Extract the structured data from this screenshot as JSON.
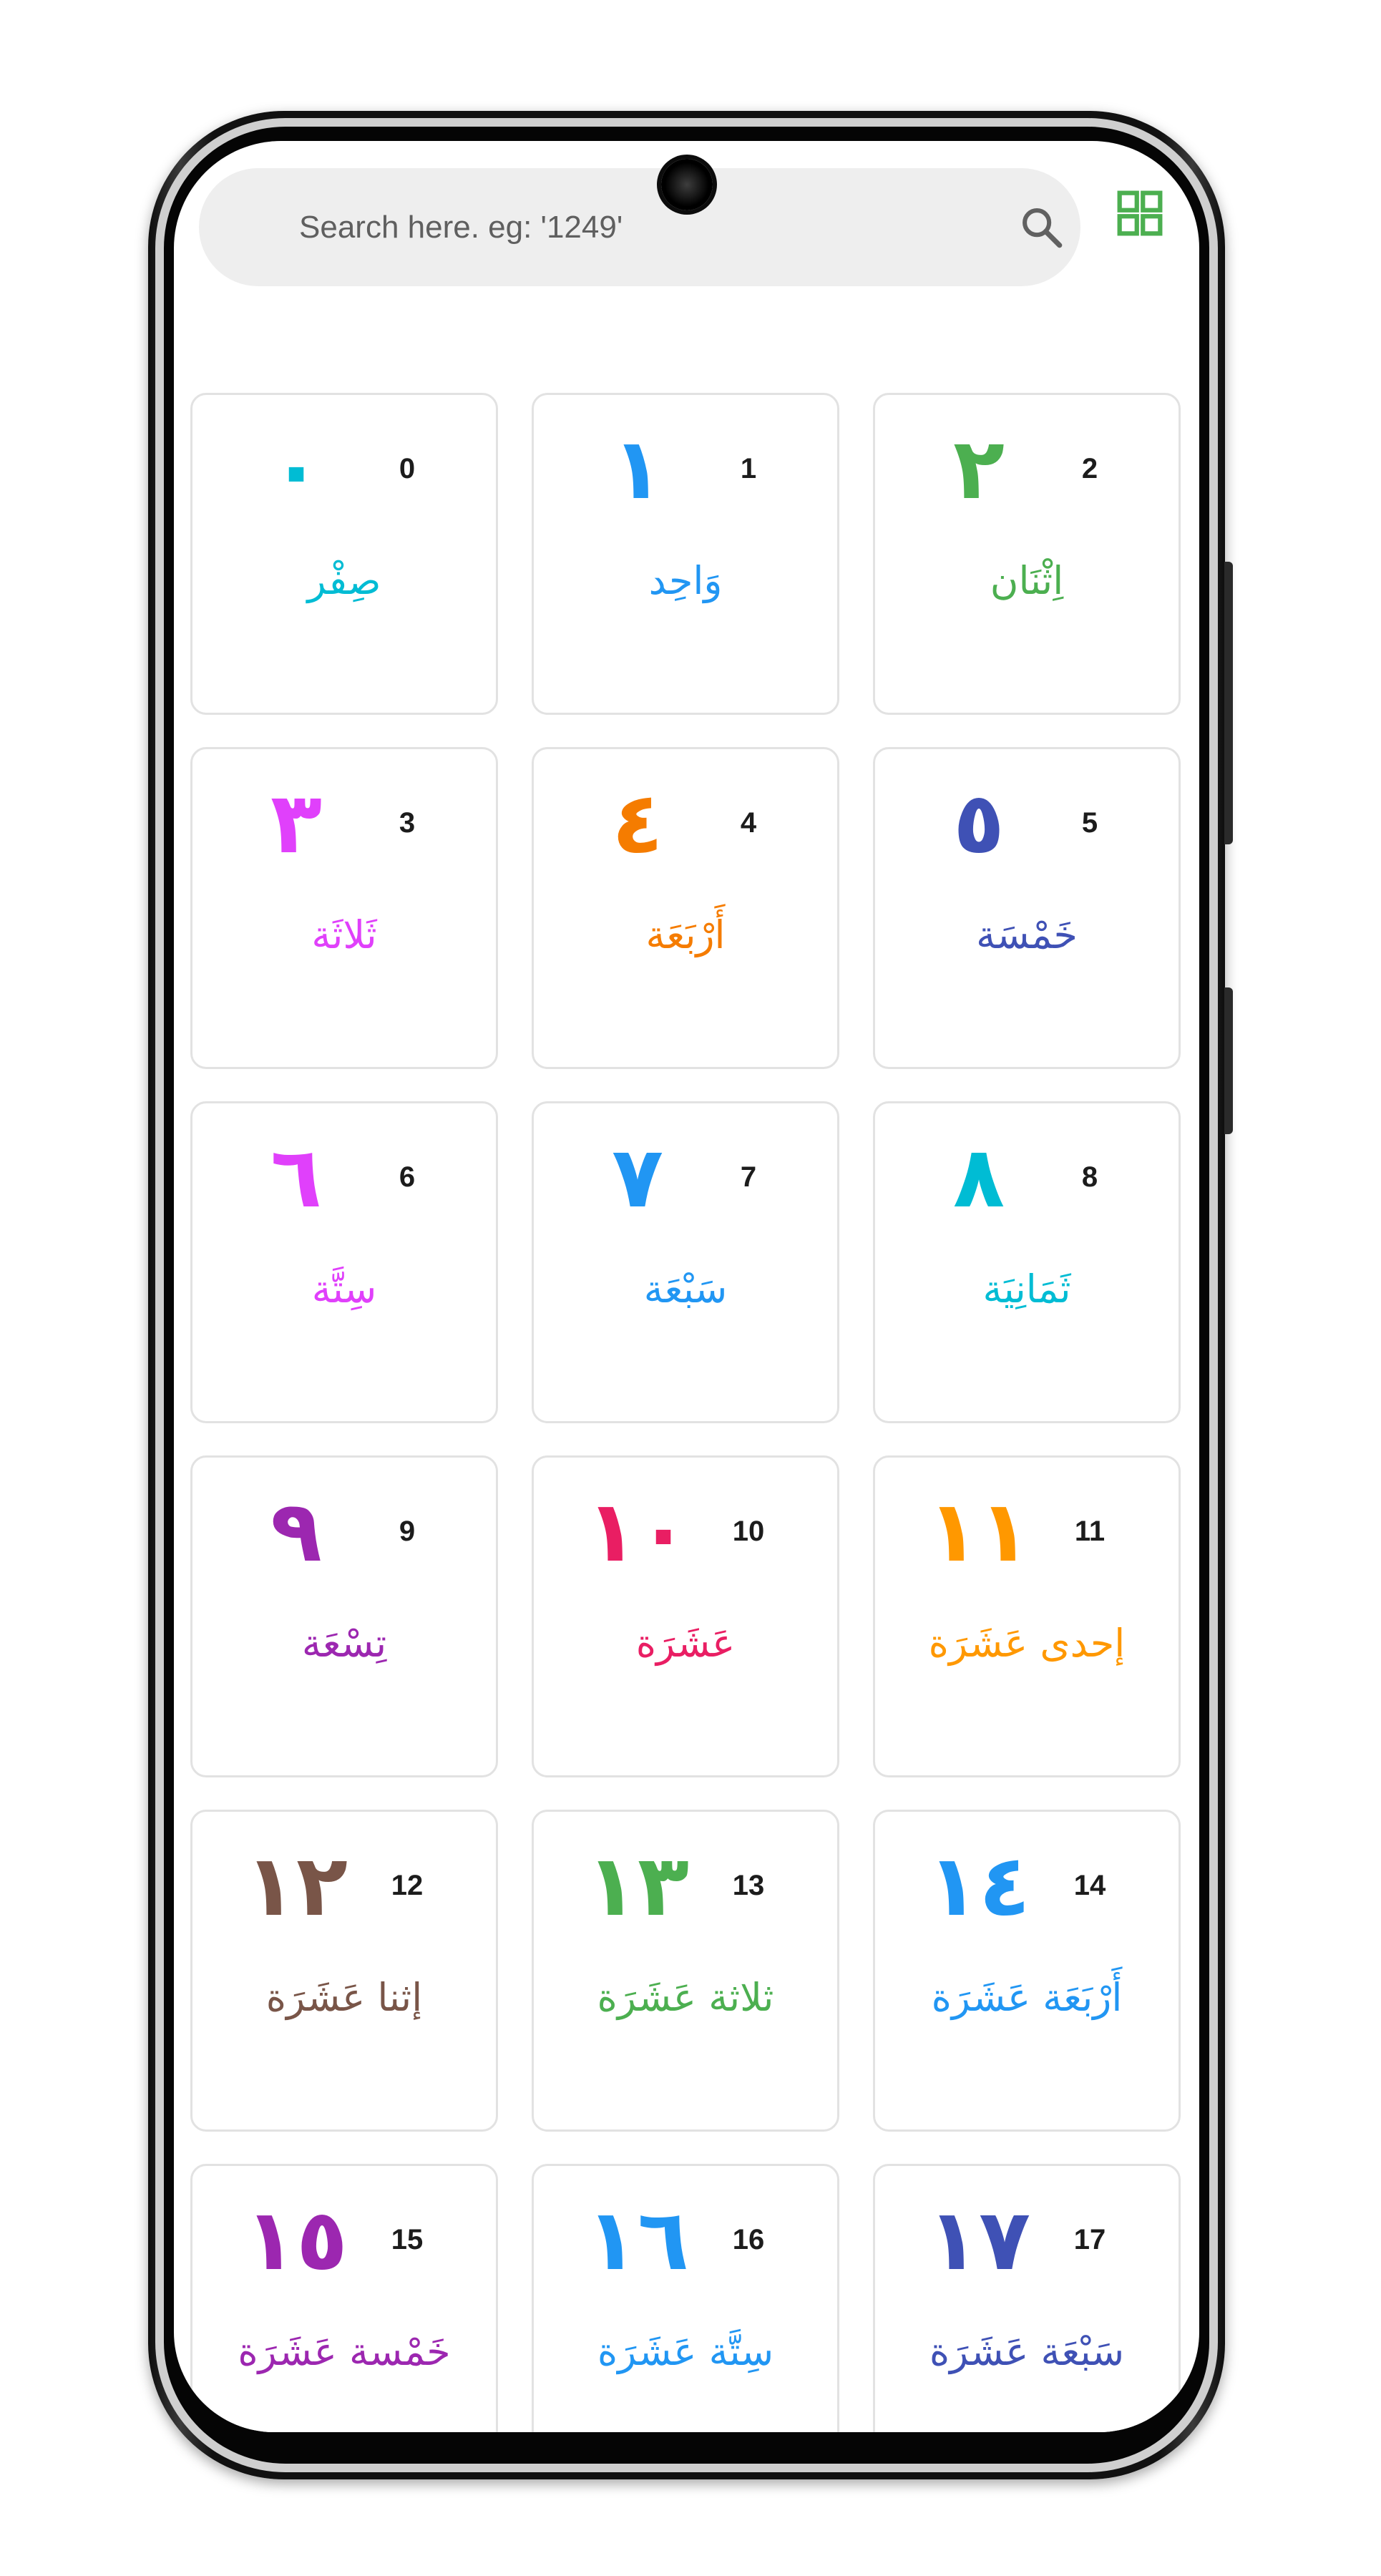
{
  "search": {
    "placeholder": "Search here. eg: '1249'"
  },
  "icons": {
    "search": "search-icon",
    "grid_toggle": "grid-view-icon"
  },
  "colors": {
    "accent": "#4caf50",
    "card_border": "#e2e2e2",
    "search_bg": "#eeeeee"
  },
  "numbers": [
    {
      "digit": "0",
      "arabic": "٠",
      "word": "صِفْر",
      "color": "#00bcd4"
    },
    {
      "digit": "1",
      "arabic": "١",
      "word": "وَاحِد",
      "color": "#2196f3"
    },
    {
      "digit": "2",
      "arabic": "٢",
      "word": "اِثْنَان",
      "color": "#4caf50"
    },
    {
      "digit": "3",
      "arabic": "٣",
      "word": "ثَلاثَة",
      "color": "#e040fb"
    },
    {
      "digit": "4",
      "arabic": "٤",
      "word": "أَرْبَعَة",
      "color": "#f57c00"
    },
    {
      "digit": "5",
      "arabic": "٥",
      "word": "خَمْسَة",
      "color": "#3f51b5"
    },
    {
      "digit": "6",
      "arabic": "٦",
      "word": "سِتَّة",
      "color": "#e040fb"
    },
    {
      "digit": "7",
      "arabic": "٧",
      "word": "سَبْعَة",
      "color": "#2196f3"
    },
    {
      "digit": "8",
      "arabic": "٨",
      "word": "ثَمَانِيَة",
      "color": "#00bcd4"
    },
    {
      "digit": "9",
      "arabic": "٩",
      "word": "تِسْعَة",
      "color": "#9c27b0"
    },
    {
      "digit": "10",
      "arabic": "١٠",
      "word": "عَشَرَة",
      "color": "#e91e63"
    },
    {
      "digit": "11",
      "arabic": "١١",
      "word": "إحدى عَشَرَة",
      "color": "#ff9800"
    },
    {
      "digit": "12",
      "arabic": "١٢",
      "word": "إثنا عَشَرَة",
      "color": "#795548"
    },
    {
      "digit": "13",
      "arabic": "١٣",
      "word": "ثلاثة عَشَرَة",
      "color": "#4caf50"
    },
    {
      "digit": "14",
      "arabic": "١٤",
      "word": "أَرْبَعَة عَشَرَة",
      "color": "#2196f3"
    },
    {
      "digit": "15",
      "arabic": "١٥",
      "word": "خَمْسة عَشَرَة",
      "color": "#9c27b0"
    },
    {
      "digit": "16",
      "arabic": "١٦",
      "word": "سِتَّة عَشَرَة",
      "color": "#2196f3"
    },
    {
      "digit": "17",
      "arabic": "١٧",
      "word": "سَبْعَة عَشَرَة",
      "color": "#3f51b5"
    }
  ]
}
